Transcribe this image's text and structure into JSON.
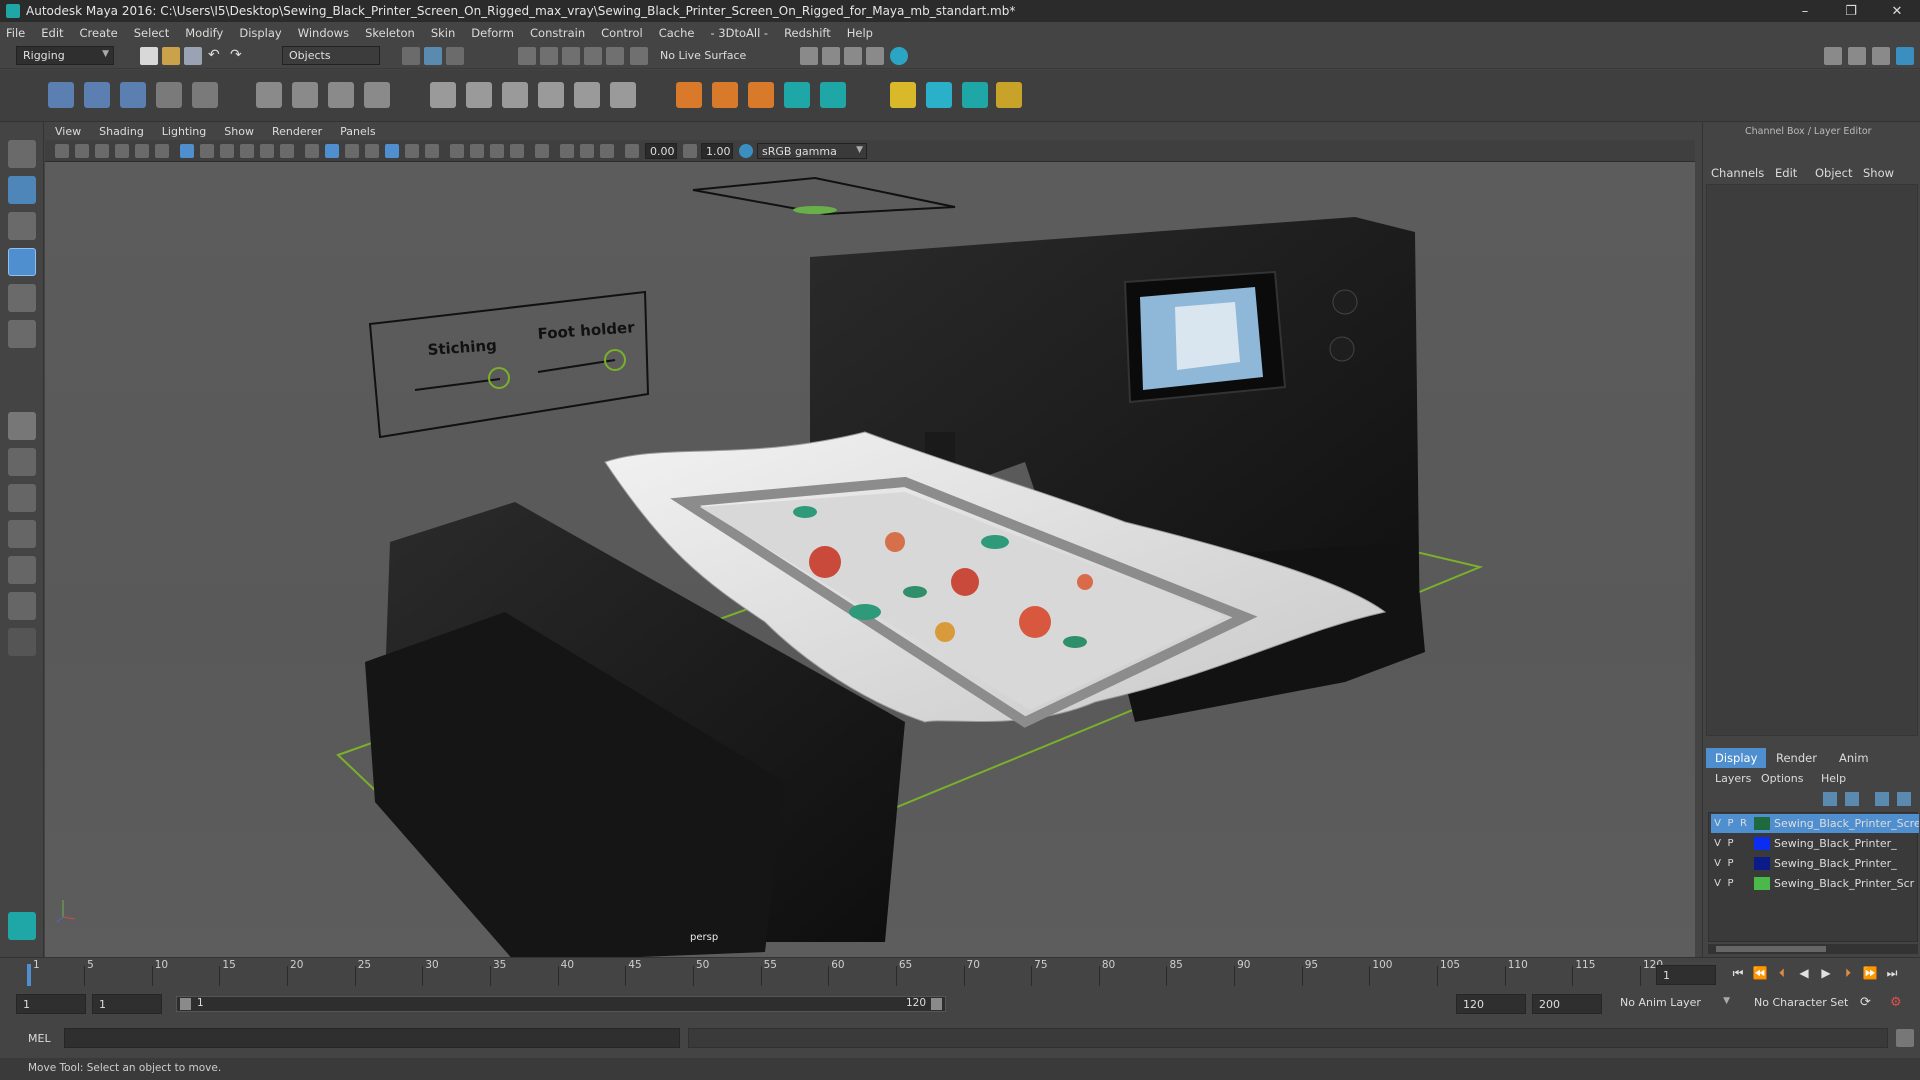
{
  "window": {
    "title": "Autodesk Maya 2016: C:\\Users\\I5\\Desktop\\Sewing_Black_Printer_Screen_On_Rigged_max_vray\\Sewing_Black_Printer_Screen_On_Rigged_for_Maya_mb_standart.mb*",
    "minimize": "–",
    "maximize": "❐",
    "close": "✕"
  },
  "menubar": [
    "File",
    "Edit",
    "Create",
    "Select",
    "Modify",
    "Display",
    "Windows",
    "Skeleton",
    "Skin",
    "Deform",
    "Constrain",
    "Control",
    "Cache",
    "- 3DtoAll -",
    "Redshift",
    "Help"
  ],
  "statusline": {
    "menuset": "Rigging",
    "selection_mode": "Objects",
    "live_surface": "No Live Surface"
  },
  "panel": {
    "menus": [
      "View",
      "Shading",
      "Lighting",
      "Show",
      "Renderer",
      "Panels"
    ],
    "exposure": "0.00",
    "gamma": "1.00",
    "colorspace": "sRGB gamma",
    "camera_label": "persp"
  },
  "scene": {
    "slider_labels": [
      "Stiching",
      "Foot holder"
    ]
  },
  "rightpanel": {
    "header": "Channel Box / Layer Editor",
    "channel_menus": [
      "Channels",
      "Edit",
      "Object",
      "Show"
    ],
    "tabs": [
      "Display",
      "Render",
      "Anim"
    ],
    "layer_menus": [
      "Layers",
      "Options",
      "Help"
    ],
    "layers": [
      {
        "v": "V",
        "p": "P",
        "r": "R",
        "color": "#1e6a3e",
        "name": "Sewing_Black_Printer_Screen",
        "selected": true
      },
      {
        "v": "V",
        "p": "P",
        "r": "",
        "color": "#0a2df0",
        "name": "Sewing_Black_Printer_",
        "selected": false
      },
      {
        "v": "V",
        "p": "P",
        "r": "",
        "color": "#0b1c8a",
        "name": "Sewing_Black_Printer_",
        "selected": false
      },
      {
        "v": "V",
        "p": "P",
        "r": "",
        "color": "#4bb84a",
        "name": "Sewing_Black_Printer_Scr",
        "selected": false
      }
    ]
  },
  "timeline": {
    "ticks": [
      "1",
      "5",
      "10",
      "15",
      "20",
      "25",
      "30",
      "35",
      "40",
      "45",
      "50",
      "55",
      "60",
      "65",
      "70",
      "75",
      "80",
      "85",
      "90",
      "95",
      "100",
      "105",
      "110",
      "115",
      "120"
    ],
    "current_frame": "1"
  },
  "range": {
    "start": "1",
    "playback_start": "1",
    "slider_start": "1",
    "slider_end": "120",
    "playback_end": "120",
    "end": "200",
    "anim_layer": "No Anim Layer",
    "character_set": "No Character Set"
  },
  "cmdline": {
    "label": "MEL"
  },
  "helpline": {
    "text": "Move Tool: Select an object to move."
  }
}
